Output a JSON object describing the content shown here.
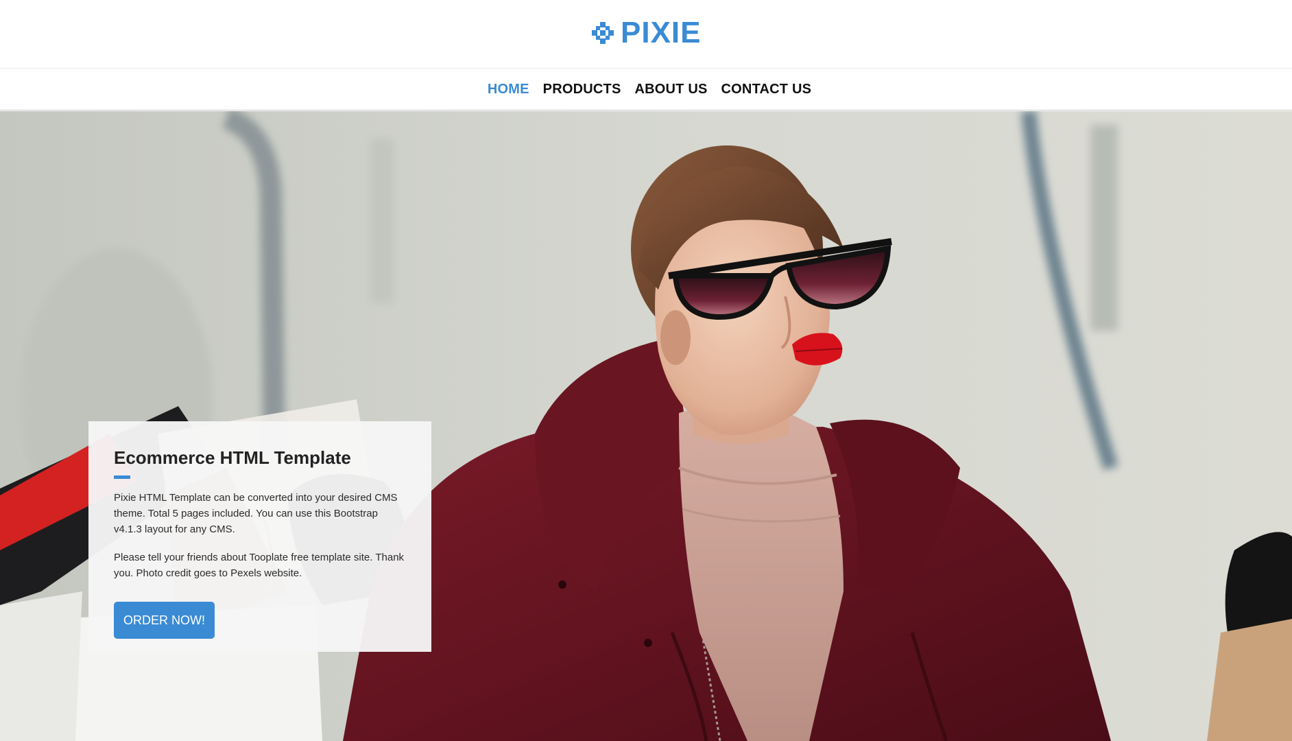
{
  "brand": {
    "name": "PIXIE",
    "icon": "pixel-diamond-icon",
    "color": "#3a8bd4"
  },
  "nav": {
    "items": [
      {
        "label": "HOME",
        "active": true
      },
      {
        "label": "PRODUCTS",
        "active": false
      },
      {
        "label": "ABOUT US",
        "active": false
      },
      {
        "label": "CONTACT US",
        "active": false
      }
    ]
  },
  "hero": {
    "image": "woman-in-sunglasses-with-shopping-bags-photo",
    "card": {
      "title": "Ecommerce HTML Template",
      "paragraph1": "Pixie HTML Template can be converted into your desired CMS theme. Total 5 pages included. You can use this Bootstrap v4.1.3 layout for any CMS.",
      "paragraph2": "Please tell your friends about Tooplate free template site. Thank you. Photo credit goes to Pexels website.",
      "button_label": "ORDER NOW!"
    }
  },
  "colors": {
    "accent": "#3a8bd4",
    "coat": "#6d1521",
    "lips": "#d8121c"
  }
}
